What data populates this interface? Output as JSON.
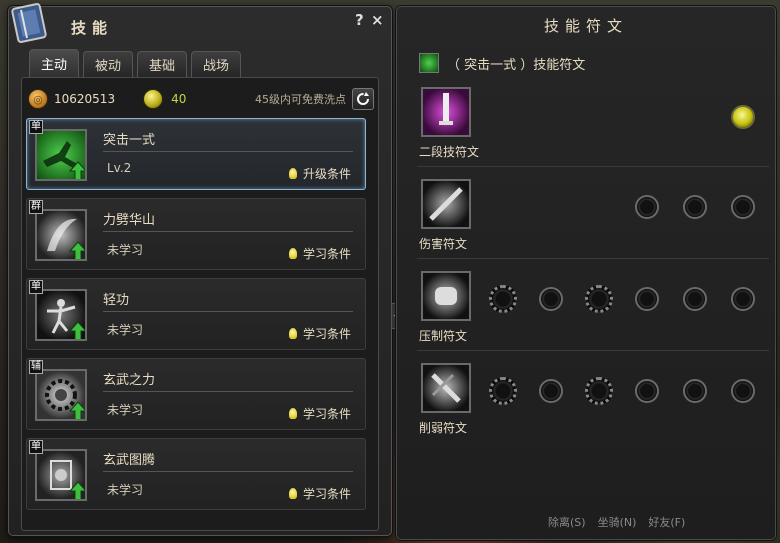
{
  "left_panel": {
    "title": "技能",
    "help_label": "?",
    "close_label": "×",
    "tabs": [
      {
        "label": "主动",
        "active": true
      },
      {
        "label": "被动",
        "active": false
      },
      {
        "label": "基础",
        "active": false
      },
      {
        "label": "战场",
        "active": false
      }
    ],
    "stats": {
      "coin_value": "10620513",
      "gem_value": "40",
      "free_reset_text": "45级内可免费洗点"
    },
    "skills": [
      {
        "type_badge": "单",
        "name": "突击一式",
        "status": "Lv.2",
        "condition": "升级条件",
        "selected": true
      },
      {
        "type_badge": "群",
        "name": "力劈华山",
        "status": "未学习",
        "condition": "学习条件",
        "selected": false
      },
      {
        "type_badge": "单",
        "name": "轻功",
        "status": "未学习",
        "condition": "学习条件",
        "selected": false
      },
      {
        "type_badge": "辅",
        "name": "玄武之力",
        "status": "未学习",
        "condition": "学习条件",
        "selected": false
      },
      {
        "type_badge": "单",
        "name": "玄武图腾",
        "status": "未学习",
        "condition": "学习条件",
        "selected": false
      }
    ]
  },
  "right_panel": {
    "title": "技能符文",
    "header": "（ 突击一式 ）技能符文",
    "runes": [
      {
        "label": "二段技符文",
        "sockets": 1
      },
      {
        "label": "伤害符文",
        "sockets": 3
      },
      {
        "label": "压制符文",
        "sockets": 6
      },
      {
        "label": "削弱符文",
        "sockets": 6
      }
    ]
  },
  "background_menu": [
    "除离(S)",
    "坐骑(N)",
    "好友(F)"
  ],
  "colors": {
    "accent_green": "#3fbf3f",
    "socket_lit": "#e6e24a",
    "selected_border": "#8fb4d6"
  }
}
